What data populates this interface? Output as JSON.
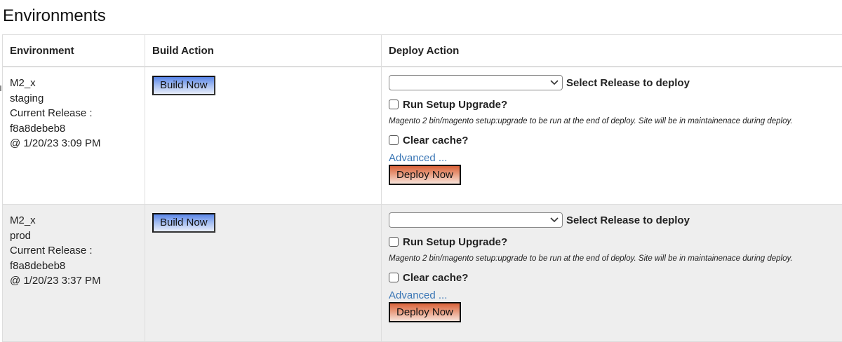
{
  "page": {
    "title": "Environments"
  },
  "table": {
    "headers": [
      "Environment",
      "Build Action",
      "Deploy Action"
    ],
    "rows": [
      {
        "env_name": "M2_x",
        "env_stage": "staging",
        "release_label": "Current Release :",
        "release_hash": "f8a8debeb8",
        "release_time": "@ 1/20/23 3:09 PM",
        "build_label": "Build Now",
        "select_release_label": "Select Release to deploy",
        "select_value": "",
        "setup_upgrade_label": "Run Setup Upgrade?",
        "setup_upgrade_note": "Magento 2 bin/magento setup:upgrade to be run at the end of deploy. Site will be in maintainenace during deploy.",
        "clear_cache_label": "Clear cache?",
        "advanced_label": "Advanced ...",
        "deploy_label": "Deploy Now"
      },
      {
        "env_name": "M2_x",
        "env_stage": "prod",
        "release_label": "Current Release :",
        "release_hash": "f8a8debeb8",
        "release_time": "@ 1/20/23 3:37 PM",
        "build_label": "Build Now",
        "select_release_label": "Select Release to deploy",
        "select_value": "",
        "setup_upgrade_label": "Run Setup Upgrade?",
        "setup_upgrade_note": "Magento 2 bin/magento setup:upgrade to be run at the end of deploy. Site will be in maintainenace during deploy.",
        "clear_cache_label": "Clear cache?",
        "advanced_label": "Advanced ...",
        "deploy_label": "Deploy Now"
      }
    ]
  },
  "colors": {
    "build_button": "#7b9ff0",
    "deploy_button": "#e07a55",
    "link": "#3a76b5",
    "row_alt_bg": "#eeeeee"
  },
  "icons": {
    "select_chevron": "chevron-down-icon"
  }
}
